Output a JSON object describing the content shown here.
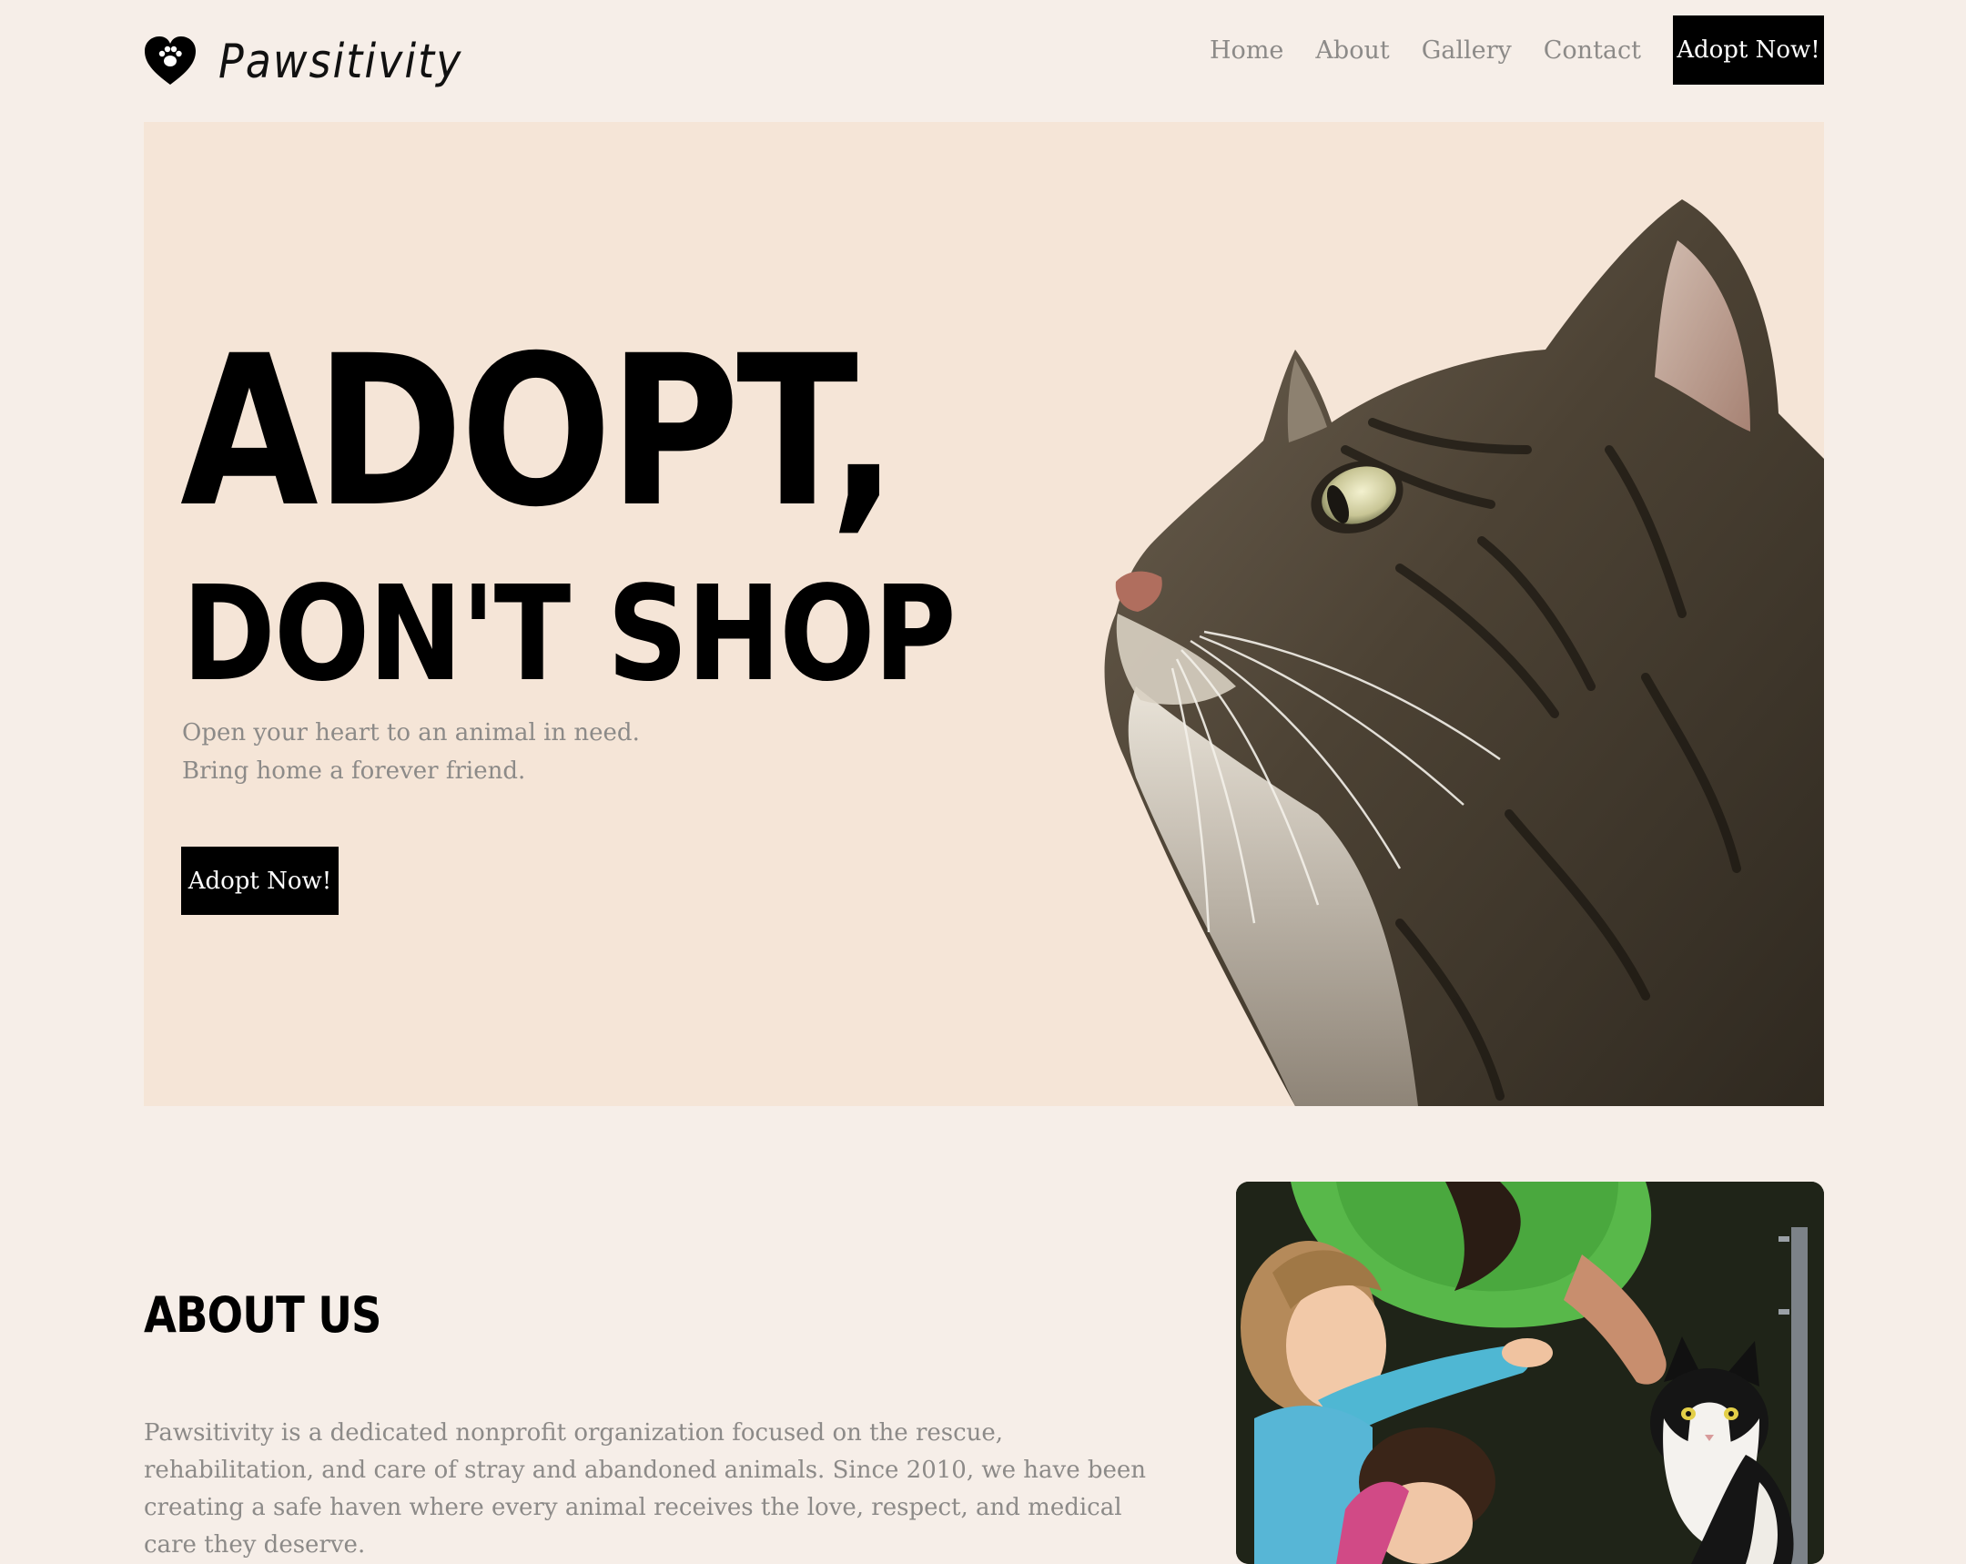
{
  "brand": {
    "name": "Pawsitivity",
    "logo_icon": "heart-paw-icon"
  },
  "nav": {
    "items": [
      "Home",
      "About",
      "Gallery",
      "Contact"
    ],
    "cta_label": "Adopt Now!"
  },
  "hero": {
    "title_line1": "ADOPT,",
    "title_line2": "DON'T SHOP",
    "subtitle_line1": "Open your heart to an animal in need.",
    "subtitle_line2": "Bring home a forever friend.",
    "cta_label": "Adopt Now!",
    "image": "tabby-cat-profile"
  },
  "about": {
    "title": "ABOUT US",
    "text": "Pawsitivity is a dedicated nonprofit organization focused on the rescue, rehabilitation, and care of stray and abandoned animals. Since 2010, we have been creating a safe haven where every animal receives the love, respect, and medical care they deserve.",
    "image": "children-petting-cat"
  },
  "colors": {
    "page_bg": "#f6eee8",
    "hero_bg": "#f5e5d7",
    "text_muted": "#8c8a88",
    "button_bg": "#000000",
    "button_text": "#ffffff"
  }
}
